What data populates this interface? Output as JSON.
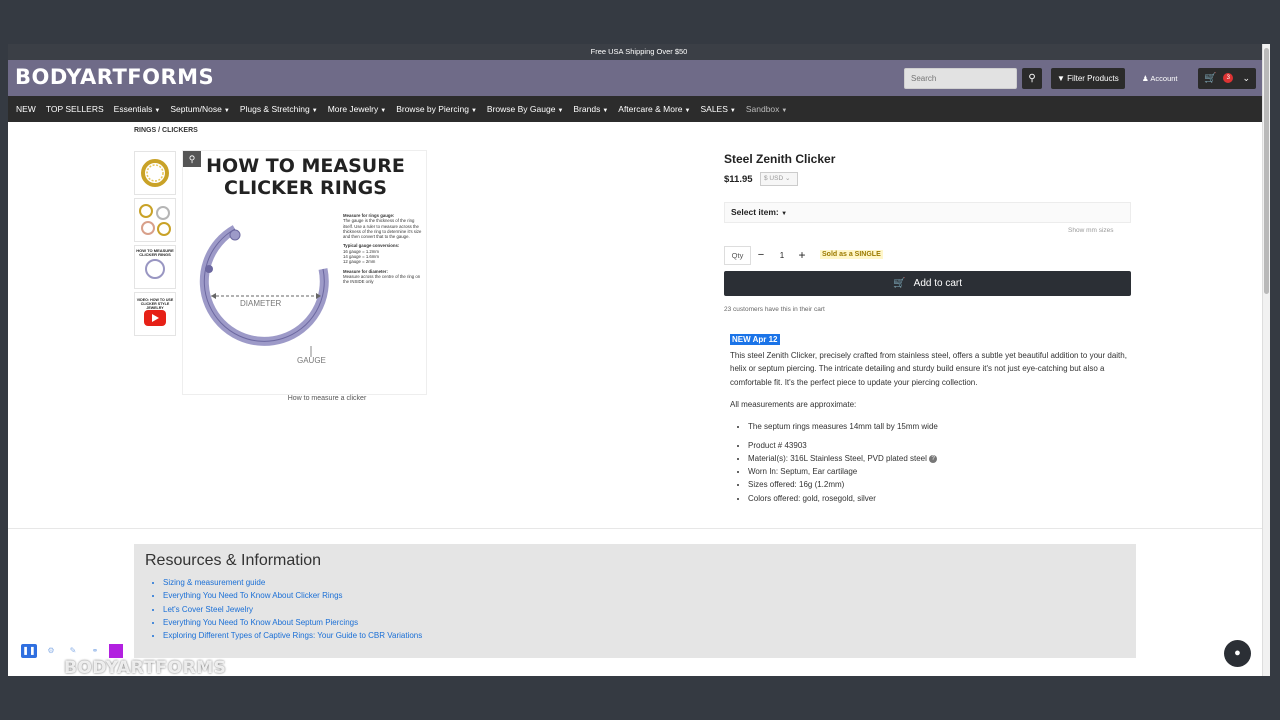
{
  "topbar": {
    "text": "Free USA Shipping Over $50"
  },
  "header": {
    "logo": "BODYARTFORMS",
    "search_placeholder": "Search",
    "filter_label": "Filter Products",
    "account_label": "Account",
    "cart_count": "3"
  },
  "nav": {
    "items": [
      {
        "label": "NEW",
        "caret": false
      },
      {
        "label": "TOP SELLERS",
        "caret": false
      },
      {
        "label": "Essentials",
        "caret": true
      },
      {
        "label": "Septum/Nose",
        "caret": true
      },
      {
        "label": "Plugs & Stretching",
        "caret": true
      },
      {
        "label": "More Jewelry",
        "caret": true
      },
      {
        "label": "Browse by Piercing",
        "caret": true
      },
      {
        "label": "Browse By Gauge",
        "caret": true
      },
      {
        "label": "Brands",
        "caret": true
      },
      {
        "label": "Aftercare & More",
        "caret": true
      },
      {
        "label": "SALES",
        "caret": true
      },
      {
        "label": "Sandbox",
        "caret": true
      }
    ]
  },
  "breadcrumb": {
    "level1": "RINGS",
    "sep": "/",
    "level2": "CLICKERS"
  },
  "gallery": {
    "main_title_line1": "HOW TO MEASURE",
    "main_title_line2": "CLICKER RINGS",
    "diameter_label": "DIAMETER",
    "gauge_label": "GAUGE",
    "side_heading1": "Measure for rings gauge:",
    "side_text1": "The gauge is the thickness of the ring itself. Use a ruler to measure across the thickness of the ring to determine it's size and then convert that to the gauge.",
    "side_heading2": "Typical gauge conversions:",
    "side_text2a": "16 gauge = 1.2mm",
    "side_text2b": "14 gauge = 1.6mm",
    "side_text2c": "12 gauge = 2mm",
    "side_heading3": "Measure for diameter:",
    "side_text3": "Measure across the centre of the ring on the INSIDE only",
    "caption": "How to measure a clicker",
    "thumb3_text": "HOW TO MEASURE CLICKER RINGS",
    "thumb4_text": "VIDEO: HOW TO USE CLICKER STYLE JEWELRY"
  },
  "product": {
    "title": "Steel Zenith Clicker",
    "price": "$11.95",
    "currency": "$ USD",
    "select_label": "Select item:",
    "show_sizes": "Show mm sizes",
    "qty_label": "Qty",
    "qty_value": "1",
    "sold_as": "Sold as a SINGLE",
    "add_to_cart": "Add to cart",
    "customers_text": "23 customers have this in their cart",
    "new_badge": "NEW Apr 12",
    "description": "This steel Zenith Clicker, precisely crafted from stainless steel, offers a subtle yet beautiful addition to your daith, helix or septum piercing. The intricate detailing and sturdy build ensure it's not just eye-catching but also a comfortable fit. It's the perfect piece to update your piercing collection.",
    "measure_note": "All measurements are approximate:",
    "measure_bullet": "The septum rings measures 14mm tall by 15mm wide",
    "details": [
      "Product # 43903",
      "Material(s): 316L Stainless Steel, PVD plated steel",
      "Worn In: Septum, Ear cartilage",
      "Sizes offered: 16g (1.2mm)",
      "Colors offered: gold, rosegold, silver"
    ]
  },
  "resources": {
    "heading": "Resources & Information",
    "links": [
      "Sizing & measurement guide",
      "Everything You Need To Know About Clicker Rings",
      "Let's Cover Steel Jewelry",
      "Everything You Need To Know About Septum Piercings",
      "Exploring Different Types of Captive Rings: Your Guide to CBR Variations"
    ]
  },
  "overlay": {
    "watermark": "BODYARTFORMS"
  },
  "colors": {
    "header": "#6f6b88",
    "nav": "#2c2c2c",
    "link": "#1a6fd6",
    "badge": "#1b74e8"
  }
}
